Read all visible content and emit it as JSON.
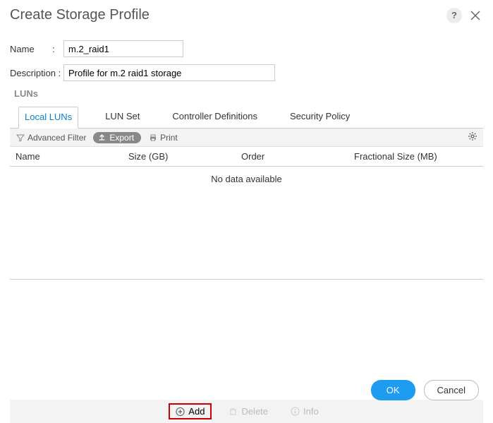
{
  "dialog": {
    "title": "Create Storage Profile",
    "help": "?"
  },
  "form": {
    "name_label": "Name",
    "name_value": "m.2_raid1",
    "desc_label": "Description :",
    "desc_value": "Profile for m.2 raid1 storage",
    "colon": ":"
  },
  "luns": {
    "section_label": "LUNs",
    "tabs": {
      "local": "Local LUNs",
      "lunset": "LUN Set",
      "controller": "Controller Definitions",
      "security": "Security Policy"
    },
    "toolbar": {
      "advanced_filter": "Advanced Filter",
      "export": "Export",
      "print": "Print"
    },
    "columns": {
      "name": "Name",
      "size": "Size (GB)",
      "order": "Order",
      "frac": "Fractional Size (MB)"
    },
    "empty_text": "No data available",
    "actions": {
      "add": "Add",
      "delete": "Delete",
      "info": "Info"
    }
  },
  "footer": {
    "ok": "OK",
    "cancel": "Cancel"
  }
}
